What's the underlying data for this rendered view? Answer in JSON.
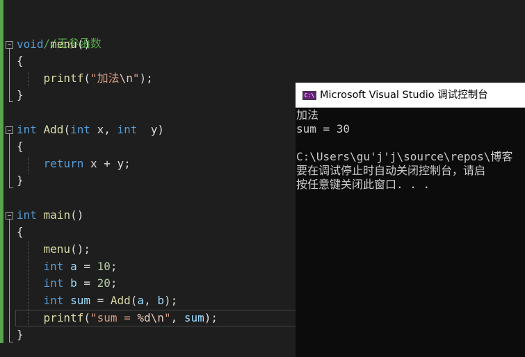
{
  "editor": {
    "line1": {
      "comment": "//无参函数"
    },
    "line2": {
      "kw": "void",
      "name": " menu",
      "paren": "()"
    },
    "line3": {
      "brace": "{"
    },
    "line4": {
      "fn": "printf",
      "open": "(",
      "str": "\"加法",
      "esc": "\\n",
      "close": "\"",
      "end": ");"
    },
    "line5": {
      "brace": "}"
    },
    "line7": {
      "kw": "int",
      "name": " Add",
      "open": "(",
      "kw2": "int",
      "p1": " x",
      "comma": ", ",
      "kw3": "int",
      "p2": "  y",
      "close": ")"
    },
    "line8": {
      "brace": "{"
    },
    "line9": {
      "kw": "return",
      "x": " x",
      "plus": " + ",
      "y": "y",
      "semi": ";"
    },
    "line10": {
      "brace": "}"
    },
    "line12": {
      "kw": "int",
      "name": " main",
      "paren": "()"
    },
    "line13": {
      "brace": "{"
    },
    "line14": {
      "fn": "menu",
      "rest": "();"
    },
    "line15": {
      "kw": "int",
      "var": " a",
      "op": " = ",
      "num": "10",
      "semi": ";"
    },
    "line16": {
      "kw": "int",
      "var": " b",
      "op": " = ",
      "num": "20",
      "semi": ";"
    },
    "line17": {
      "kw": "int",
      "var": " sum",
      "op": " = ",
      "fn": "Add",
      "open": "(",
      "a": "a",
      "comma": ", ",
      "b": "b",
      "close": ");"
    },
    "line18": {
      "fn": "printf",
      "open": "(",
      "str1": "\"sum = ",
      "fmt": "%d",
      "esc": "\\n",
      "str2": "\"",
      "comma": ", ",
      "var": "sum",
      "close": ");"
    },
    "line19": {
      "brace": "}"
    }
  },
  "console": {
    "icon_label": "C:\\",
    "title": "Microsoft Visual Studio 调试控制台",
    "lines": [
      "加法",
      "sum = 30",
      "",
      "C:\\Users\\gu'j'j\\source\\repos\\博客",
      "要在调试停止时自动关闭控制台，请启",
      "按任意键关闭此窗口. . ."
    ]
  },
  "colors": {
    "background": "#1e1e1e",
    "keyword": "#569cd6",
    "function": "#dcdcaa",
    "string": "#d69d85",
    "variable": "#9cdcfe",
    "number": "#b5cea8",
    "comment": "#57a64a",
    "console_bg": "#0c0c0c",
    "console_text": "#cccccc"
  },
  "icons": [
    "collapse-icon",
    "console-app-icon"
  ]
}
